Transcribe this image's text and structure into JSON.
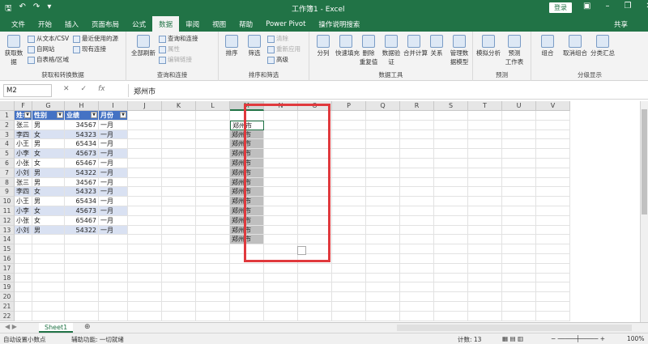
{
  "titlebar": {
    "title": "工作簿1 - Excel",
    "login": "登录",
    "qa_icons": [
      "save-icon",
      "undo-icon",
      "redo-icon",
      "customize-icon"
    ]
  },
  "tabs": [
    "文件",
    "开始",
    "插入",
    "页面布局",
    "公式",
    "数据",
    "审阅",
    "视图",
    "帮助",
    "Power Pivot",
    "操作说明搜索"
  ],
  "active_tab": "数据",
  "share": "共享",
  "ribbon": {
    "get_data": {
      "big": "获取数\n据",
      "small": [
        "从文本/CSV",
        "自网站",
        "自表格/区域"
      ],
      "recent": [
        "最近使用的源",
        "现有连接"
      ],
      "label": "获取和转换数据"
    },
    "queries": {
      "big": "全部刷新",
      "small": [
        "查询和连接",
        "属性",
        "编辑链接"
      ],
      "label": "查询和连接"
    },
    "sort": {
      "buttons": [
        "排序",
        "筛选"
      ],
      "small": [
        "清除",
        "重新应用",
        "高级"
      ],
      "label": "排序和筛选"
    },
    "tools": {
      "buttons": [
        "分列",
        "快速填充",
        "删除\n重复值",
        "数据验\n证",
        "合并计算",
        "关系",
        "管理数\n据模型"
      ],
      "label": "数据工具"
    },
    "forecast": {
      "buttons": [
        "模拟分析",
        "预测\n工作表"
      ],
      "label": "预测"
    },
    "outline": {
      "buttons": [
        "组合",
        "取消组合",
        "分类汇总"
      ],
      "label": "分级显示"
    }
  },
  "formula_bar": {
    "name_box": "M2",
    "fx": "fx",
    "value": "郑州市"
  },
  "columns": [
    "F",
    "G",
    "H",
    "I",
    "J",
    "K",
    "L",
    "M",
    "N",
    "O",
    "P",
    "Q",
    "R",
    "S",
    "T",
    "U",
    "V"
  ],
  "selected_column": "M",
  "rows": [
    1,
    2,
    3,
    4,
    5,
    6,
    7,
    8,
    9,
    10,
    11,
    12,
    13,
    14,
    15,
    16,
    17,
    18,
    19,
    20,
    21,
    22
  ],
  "table": {
    "headers": [
      "姓名",
      "性别",
      "业绩",
      "月份"
    ],
    "rows": [
      [
        "张三",
        "男",
        "34567",
        "一月"
      ],
      [
        "李四",
        "女",
        "54323",
        "一月"
      ],
      [
        "小王",
        "男",
        "65434",
        "一月"
      ],
      [
        "小李",
        "女",
        "45673",
        "一月"
      ],
      [
        "小张",
        "女",
        "65467",
        "一月"
      ],
      [
        "小刘",
        "男",
        "54322",
        "一月"
      ],
      [
        "张三",
        "男",
        "34567",
        "一月"
      ],
      [
        "李四",
        "女",
        "54323",
        "一月"
      ],
      [
        "小王",
        "男",
        "65434",
        "一月"
      ],
      [
        "小李",
        "女",
        "45673",
        "一月"
      ],
      [
        "小张",
        "女",
        "65467",
        "一月"
      ],
      [
        "小刘",
        "男",
        "54322",
        "一月"
      ]
    ]
  },
  "column_m": [
    "郑州市",
    "郑州市",
    "郑州市",
    "郑州市",
    "郑州市",
    "郑州市",
    "郑州市",
    "郑州市",
    "郑州市",
    "郑州市",
    "郑州市",
    "郑州市",
    "郑州市"
  ],
  "sheet_tab": "Sheet1",
  "status": {
    "left": "自动设置小数点",
    "accessibility": "辅助功能: 一切就绪",
    "count": "计数: 13",
    "zoom": "100%"
  }
}
